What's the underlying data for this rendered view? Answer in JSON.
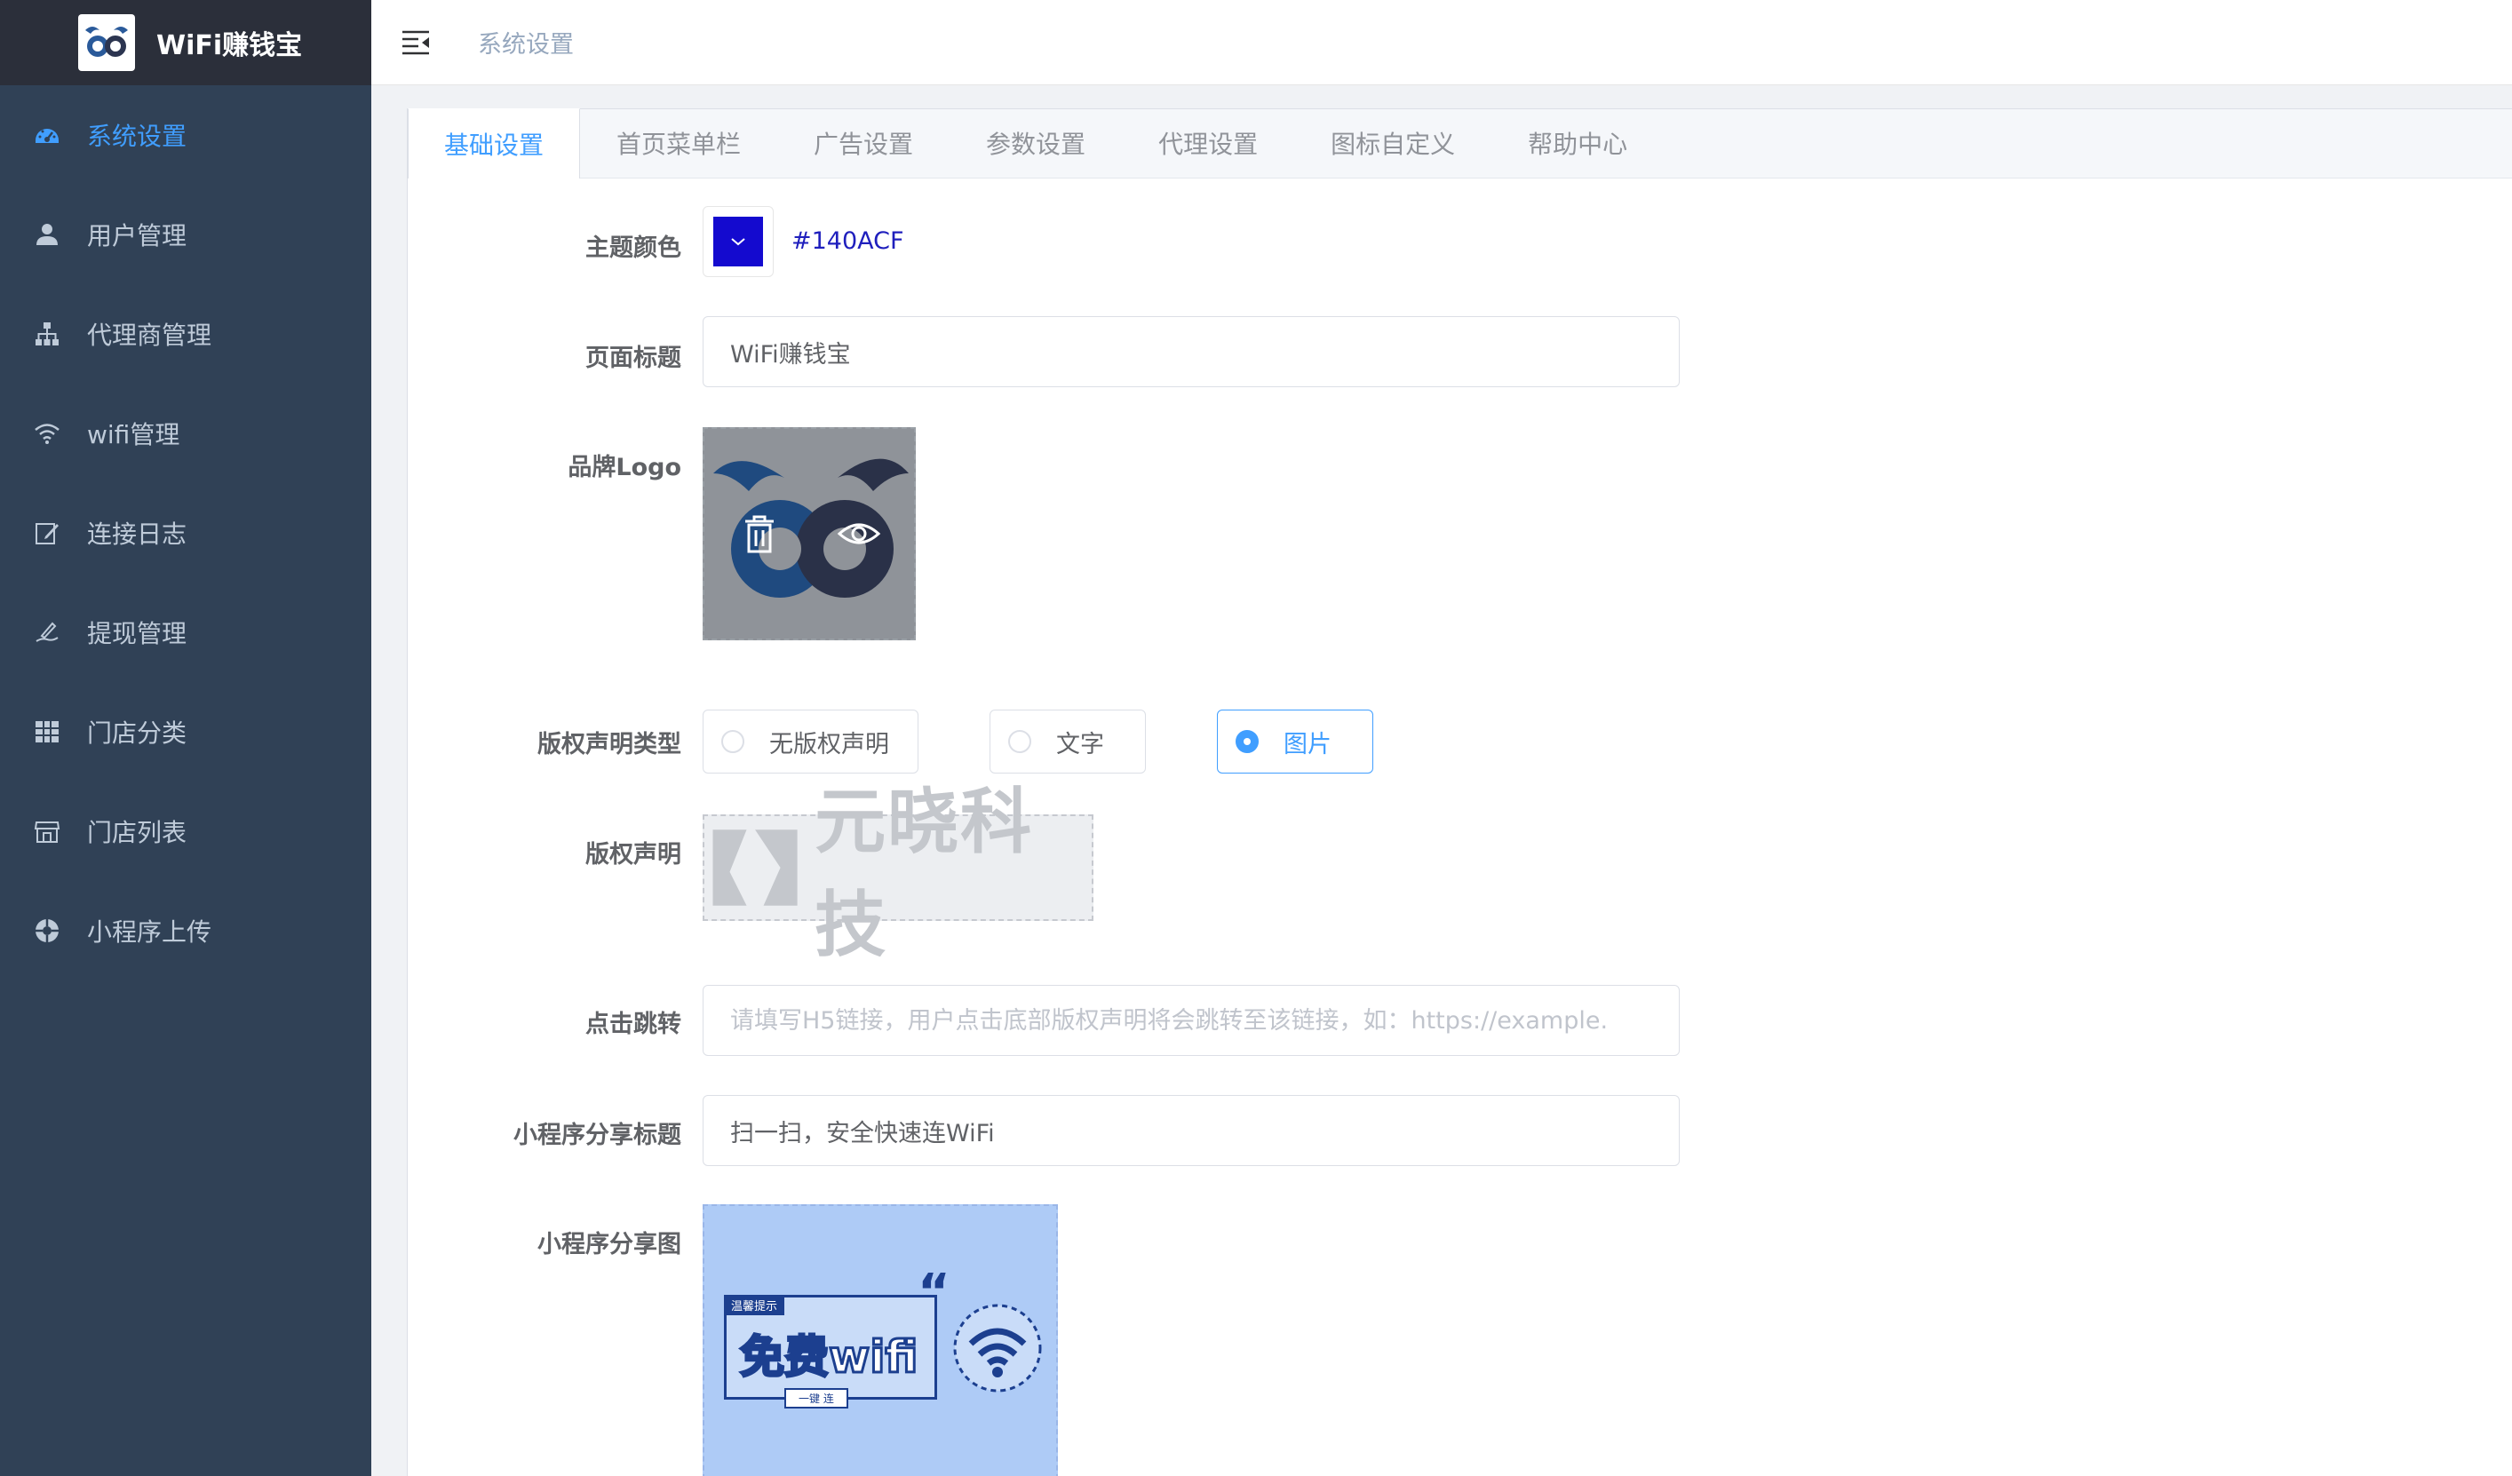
{
  "brand": {
    "title": "WiFi赚钱宝"
  },
  "sidebar": {
    "items": [
      {
        "label": "系统设置",
        "icon": "dashboard-icon",
        "active": true
      },
      {
        "label": "用户管理",
        "icon": "user-icon"
      },
      {
        "label": "代理商管理",
        "icon": "org-tree-icon"
      },
      {
        "label": "wifi管理",
        "icon": "wifi-icon"
      },
      {
        "label": "连接日志",
        "icon": "edit-log-icon"
      },
      {
        "label": "提现管理",
        "icon": "withdraw-icon"
      },
      {
        "label": "门店分类",
        "icon": "grid-icon"
      },
      {
        "label": "门店列表",
        "icon": "store-icon"
      },
      {
        "label": "小程序上传",
        "icon": "upload-ring-icon"
      }
    ]
  },
  "header": {
    "breadcrumb": "系统设置"
  },
  "tabs": [
    {
      "label": "基础设置",
      "active": true
    },
    {
      "label": "首页菜单栏"
    },
    {
      "label": "广告设置"
    },
    {
      "label": "参数设置"
    },
    {
      "label": "代理设置"
    },
    {
      "label": "图标自定义"
    },
    {
      "label": "帮助中心"
    }
  ],
  "form": {
    "theme_color": {
      "label": "主题颜色",
      "value": "#140ACF"
    },
    "page_title": {
      "label": "页面标题",
      "value": "WiFi赚钱宝"
    },
    "brand_logo": {
      "label": "品牌Logo"
    },
    "copyright_type": {
      "label": "版权声明类型",
      "options": [
        "无版权声明",
        "文字",
        "图片"
      ],
      "selected": "图片"
    },
    "copyright": {
      "label": "版权声明",
      "image_text": "元晓科技"
    },
    "click_jump": {
      "label": "点击跳转",
      "placeholder": "请填写H5链接，用户点击底部版权声明将会跳转至该链接，如：https://example."
    },
    "share_title": {
      "label": "小程序分享标题",
      "value": "扫一扫，安全快速连WiFi"
    },
    "share_image": {
      "label": "小程序分享图",
      "tag": "温馨提示",
      "headline": "免费wifi",
      "sub": "一键 连"
    }
  }
}
